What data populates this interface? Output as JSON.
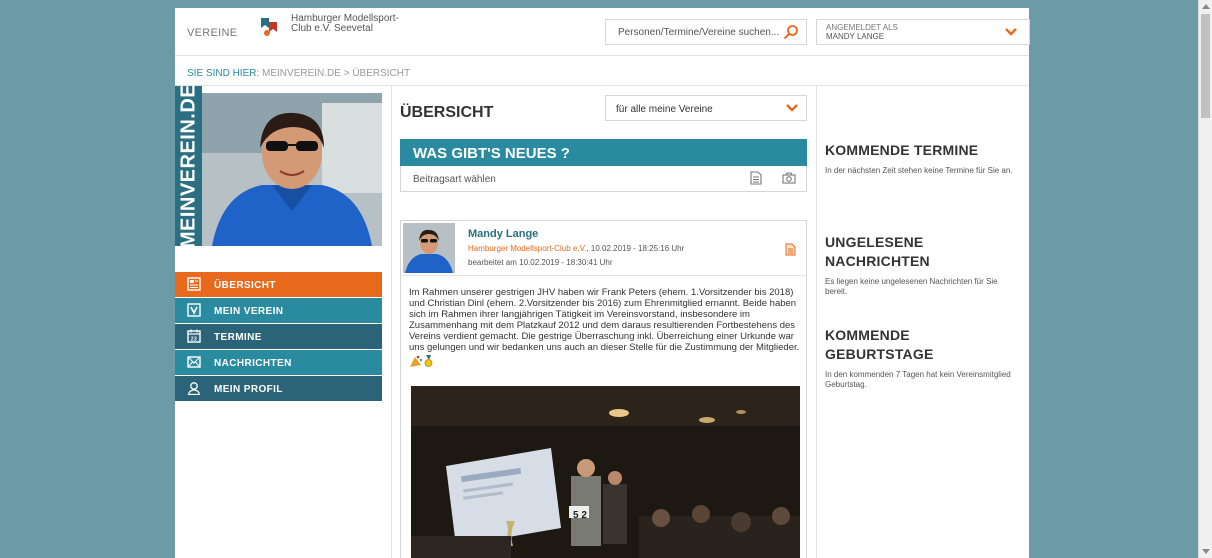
{
  "header": {
    "vereine_label": "VEREINE",
    "club_name": "Hamburger Modellsport-Club e.V. Seevetal",
    "search_placeholder": "Personen/Termine/Vereine suchen...",
    "account_label": "ANGEMELDET ALS",
    "account_name": "MANDY LANGE"
  },
  "breadcrumb": {
    "label": "SIE SIND HIER:",
    "path": "MEINVEREIN.DE > ÜBERSICHT"
  },
  "brand": "MEINVEREIN.DE",
  "nav": [
    {
      "label": "ÜBERSICHT",
      "icon": "news-icon"
    },
    {
      "label": "MEIN VEREIN",
      "icon": "v-logo-icon"
    },
    {
      "label": "TERMINE",
      "icon": "calendar-icon"
    },
    {
      "label": "NACHRICHTEN",
      "icon": "envelope-icon"
    },
    {
      "label": "MEIN PROFIL",
      "icon": "user-icon"
    }
  ],
  "main": {
    "title": "ÜBERSICHT",
    "filter_value": "für alle meine Vereine",
    "news_title": "WAS GIBT'S NEUES ?",
    "post_type_label": "Beitragsart wählen"
  },
  "post": {
    "author": "Mandy Lange",
    "club": "Hamburger Modellsport-Club e.V.",
    "date": ", 10.02.2019 - 18:25:16 Uhr",
    "edited": "bearbeitet am 10.02.2019 - 18:30:41 Uhr",
    "body": "Im Rahmen unserer gestrigen JHV haben wir Frank Peters (ehem. 1.Vorsitzender bis 2018) und Christian Dinl (ehem. 2.Vorsitzender bis 2016) zum Ehrenmitglied ernannt. Beide haben sich im Rahmen ihrer langjährigen Tätigkeit im Vereinsvorstand, insbesondere im Zusammenhang mit dem Platzkauf 2012 und dem daraus resultierenden Fortbestehens des Vereins verdient gemacht. Die gestrige Überraschung inkl. Überreichung einer Urkunde war uns gelungen und wir bedanken uns auch an dieser Stelle für die Zustimmung der Mitglieder."
  },
  "sidebar": {
    "termine_title": "KOMMENDE TERMINE",
    "termine_text": "In der nächsten Zeit stehen keine Termine für Sie an.",
    "nachrichten_title": "UNGELESENE NACHRICHTEN",
    "nachrichten_text": "Es liegen keine ungelesenen Nachrichten für Sie bereit.",
    "geburtstage_title": "KOMMENDE GEBURTSTAGE",
    "geburtstage_text": "In den kommenden 7 Tagen hat kein Vereinsmitglied Geburtstag."
  },
  "colors": {
    "accent_orange": "#e8691c",
    "accent_teal": "#2a8ba0",
    "dark_teal": "#2b6478",
    "background": "#6a9ba6"
  }
}
